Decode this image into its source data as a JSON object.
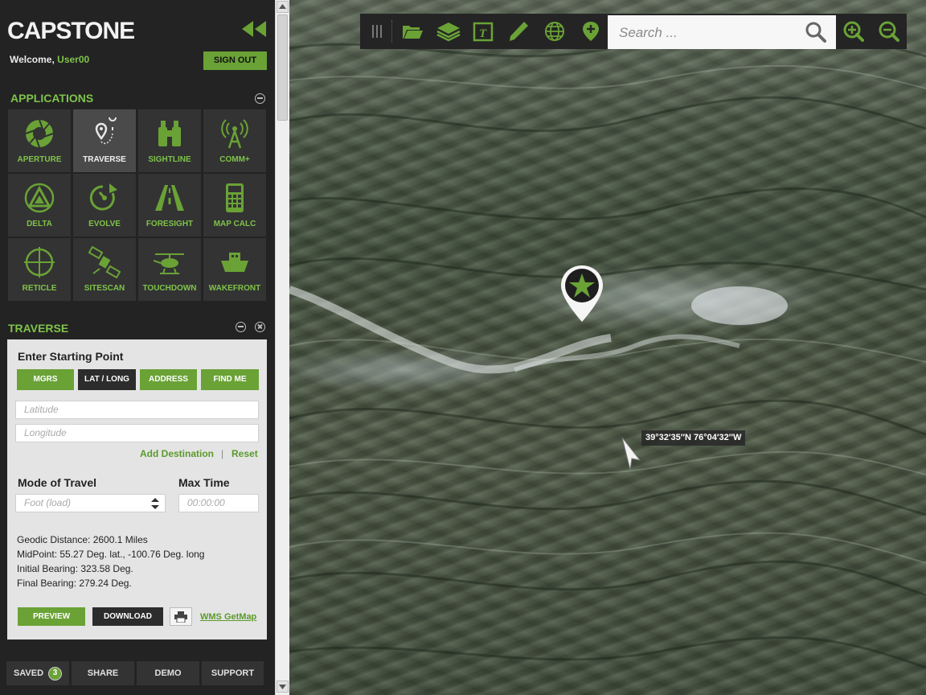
{
  "app": {
    "title": "CAPSTONE"
  },
  "user": {
    "welcome": "Welcome,",
    "name": "User00",
    "signout": "SIGN OUT"
  },
  "applications": {
    "title": "APPLICATIONS",
    "items": [
      {
        "label": "APERTURE",
        "icon": "aperture-icon"
      },
      {
        "label": "TRAVERSE",
        "icon": "route-pin-icon"
      },
      {
        "label": "SIGHTLINE",
        "icon": "binoculars-icon"
      },
      {
        "label": "COMM+",
        "icon": "radio-tower-icon"
      },
      {
        "label": "DELTA",
        "icon": "delta-triangle-icon"
      },
      {
        "label": "EVOLVE",
        "icon": "evolve-arrow-icon"
      },
      {
        "label": "FORESIGHT",
        "icon": "road-icon"
      },
      {
        "label": "MAP CALC",
        "icon": "calculator-icon"
      },
      {
        "label": "RETICLE",
        "icon": "crosshair-icon"
      },
      {
        "label": "SITESCAN",
        "icon": "satellite-icon"
      },
      {
        "label": "TOUCHDOWN",
        "icon": "helicopter-icon"
      },
      {
        "label": "WAKEFRONT",
        "icon": "boat-icon"
      }
    ]
  },
  "traverse": {
    "title": "TRAVERSE",
    "heading": "Enter Starting Point",
    "modes": [
      "MGRS",
      "LAT / LONG",
      "ADDRESS",
      "FIND ME"
    ],
    "latitude_placeholder": "Latitude",
    "longitude_placeholder": "Longitude",
    "add_destination": "Add Destination",
    "separator": "|",
    "reset": "Reset",
    "mode_of_travel_label": "Mode of Travel",
    "mode_of_travel_value": "Foot (load)",
    "max_time_label": "Max Time",
    "max_time_placeholder": "00:00:00",
    "info": [
      "Geodic Distance: 2600.1 Miles",
      "MidPoint: 55.27 Deg. lat., -100.76 Deg. long",
      "Initial Bearing: 323.58 Deg.",
      "Final Bearing: 279.24 Deg."
    ],
    "preview": "PREVIEW",
    "download": "DOWNLOAD",
    "wms": "WMS GetMap"
  },
  "bottom": {
    "saved": "SAVED",
    "saved_count": "3",
    "share": "SHARE",
    "demo": "DEMO",
    "support": "SUPPORT"
  },
  "map": {
    "search_placeholder": "Search ...",
    "coordinate": "39°32′35″N  76°04′32″W"
  },
  "colors": {
    "accent": "#6aa236",
    "accent_text": "#7fc34a",
    "sidebar": "#232323"
  }
}
